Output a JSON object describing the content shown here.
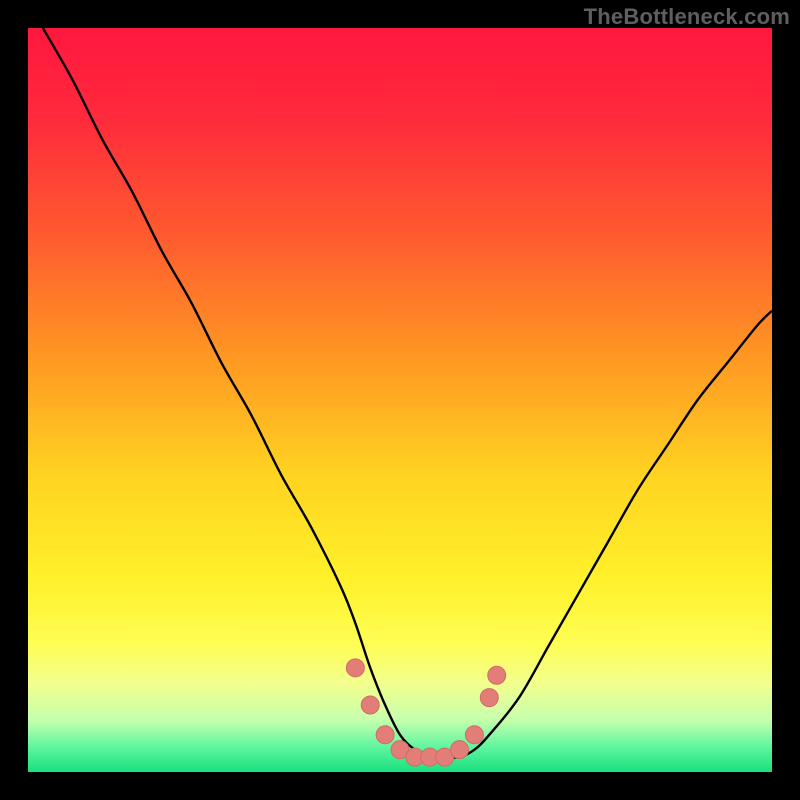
{
  "watermark": "TheBottleneck.com",
  "colors": {
    "frame": "#000000",
    "gradient_stops": [
      {
        "offset": 0.0,
        "color": "#ff173e"
      },
      {
        "offset": 0.12,
        "color": "#ff2a3c"
      },
      {
        "offset": 0.28,
        "color": "#ff5b2f"
      },
      {
        "offset": 0.45,
        "color": "#ff9a22"
      },
      {
        "offset": 0.6,
        "color": "#ffd321"
      },
      {
        "offset": 0.74,
        "color": "#fff12a"
      },
      {
        "offset": 0.83,
        "color": "#fefe55"
      },
      {
        "offset": 0.88,
        "color": "#f3ff8c"
      },
      {
        "offset": 0.93,
        "color": "#c6ffad"
      },
      {
        "offset": 0.965,
        "color": "#63f6a0"
      },
      {
        "offset": 1.0,
        "color": "#18e07e"
      }
    ],
    "curve": "#000000",
    "marker_fill": "#e37d77",
    "marker_stroke": "#d46a64"
  },
  "chart_data": {
    "type": "line",
    "title": "",
    "xlabel": "",
    "ylabel": "",
    "xlim": [
      0,
      100
    ],
    "ylim": [
      0,
      100
    ],
    "grid": false,
    "legend": false,
    "series": [
      {
        "name": "bottleneck-curve",
        "x": [
          2,
          6,
          10,
          14,
          18,
          22,
          26,
          30,
          34,
          38,
          42,
          44,
          46,
          48,
          50,
          52,
          54,
          56,
          58,
          60,
          62,
          66,
          70,
          74,
          78,
          82,
          86,
          90,
          94,
          98,
          100
        ],
        "y": [
          100,
          93,
          85,
          78,
          70,
          63,
          55,
          48,
          40,
          33,
          25,
          20,
          14,
          9,
          5,
          3,
          2,
          2,
          2,
          3,
          5,
          10,
          17,
          24,
          31,
          38,
          44,
          50,
          55,
          60,
          62
        ]
      }
    ],
    "markers": {
      "name": "highlighted-points",
      "points": [
        {
          "x": 44,
          "y": 14
        },
        {
          "x": 46,
          "y": 9
        },
        {
          "x": 48,
          "y": 5
        },
        {
          "x": 50,
          "y": 3
        },
        {
          "x": 52,
          "y": 2
        },
        {
          "x": 54,
          "y": 2
        },
        {
          "x": 56,
          "y": 2
        },
        {
          "x": 58,
          "y": 3
        },
        {
          "x": 60,
          "y": 5
        },
        {
          "x": 62,
          "y": 10
        },
        {
          "x": 63,
          "y": 13
        }
      ]
    }
  }
}
